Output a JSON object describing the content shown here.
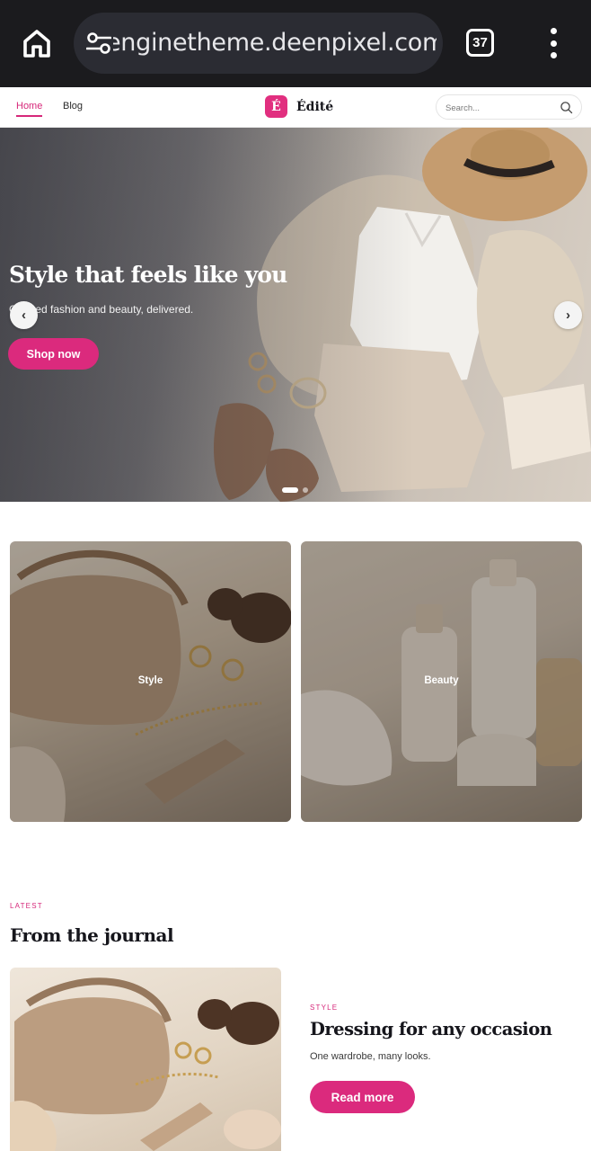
{
  "browser": {
    "url": "enginetheme.deenpixel.com",
    "tab_count": "37",
    "icons": {
      "home": "home-icon",
      "site_settings": "tune-icon",
      "menu": "more-vertical-icon"
    }
  },
  "header": {
    "nav": [
      {
        "label": "Home",
        "active": true
      },
      {
        "label": "Blog",
        "active": false
      }
    ],
    "logo": {
      "mark": "É",
      "name": "Édité"
    },
    "search": {
      "placeholder": "Search...",
      "icon": "search-icon"
    }
  },
  "hero": {
    "title": "Style that feels like you",
    "subtitle": "Curated fashion and beauty, delivered.",
    "cta_label": "Shop now",
    "prev_icon": "‹",
    "next_icon": "›",
    "slide_count": 2,
    "active_slide": 1
  },
  "categories": [
    {
      "label": "Style"
    },
    {
      "label": "Beauty"
    }
  ],
  "journal": {
    "eyebrow": "LATEST",
    "title": "From the journal",
    "post": {
      "category": "STYLE",
      "title": "Dressing for any occasion",
      "excerpt": "One wardrobe, many looks.",
      "cta_label": "Read more"
    }
  },
  "colors": {
    "accent": "#db2a7d",
    "chrome": "#1b1b1e",
    "urlbar": "#2b2c33"
  }
}
